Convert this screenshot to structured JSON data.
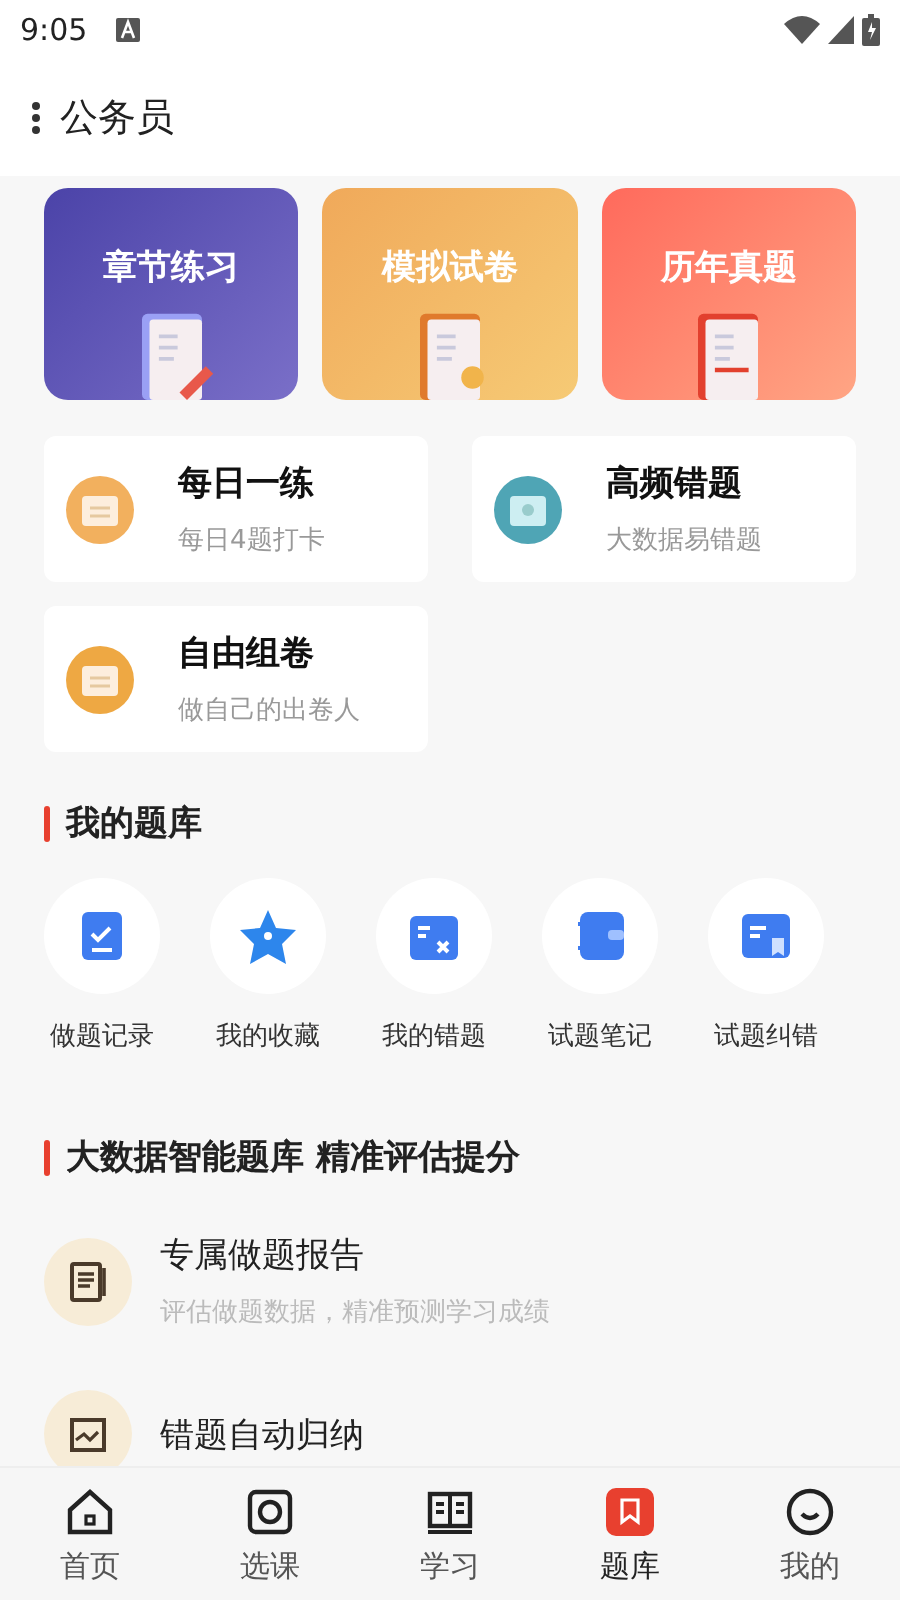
{
  "status_bar": {
    "time": "9:05"
  },
  "header": {
    "title": "公务员"
  },
  "big_cards": [
    {
      "label": "章节练习",
      "kind": "chapter"
    },
    {
      "label": "模拟试卷",
      "kind": "mock"
    },
    {
      "label": "历年真题",
      "kind": "past"
    }
  ],
  "small_cards": [
    {
      "title": "每日一练",
      "subtitle": "每日4题打卡",
      "kind": "daily"
    },
    {
      "title": "高频错题",
      "subtitle": "大数据易错题",
      "kind": "frequent"
    },
    {
      "title": "自由组卷",
      "subtitle": "做自己的出卷人",
      "kind": "custom"
    }
  ],
  "my_bank": {
    "title": "我的题库",
    "items": [
      {
        "label": "做题记录",
        "kind": "record"
      },
      {
        "label": "我的收藏",
        "kind": "favorite"
      },
      {
        "label": "我的错题",
        "kind": "wrong"
      },
      {
        "label": "试题笔记",
        "kind": "note"
      },
      {
        "label": "试题纠错",
        "kind": "correct"
      }
    ]
  },
  "features": {
    "title": "大数据智能题库 精准评估提分",
    "items": [
      {
        "title": "专属做题报告",
        "subtitle": "评估做题数据，精准预测学习成绩",
        "kind": "report"
      },
      {
        "title": "错题自动归纳",
        "kind": "collect"
      }
    ]
  },
  "tabs": [
    {
      "label": "首页",
      "kind": "home",
      "selected": false
    },
    {
      "label": "选课",
      "kind": "course",
      "selected": false
    },
    {
      "label": "学习",
      "kind": "study",
      "selected": false
    },
    {
      "label": "题库",
      "kind": "bank",
      "selected": true
    },
    {
      "label": "我的",
      "kind": "me",
      "selected": false
    }
  ]
}
